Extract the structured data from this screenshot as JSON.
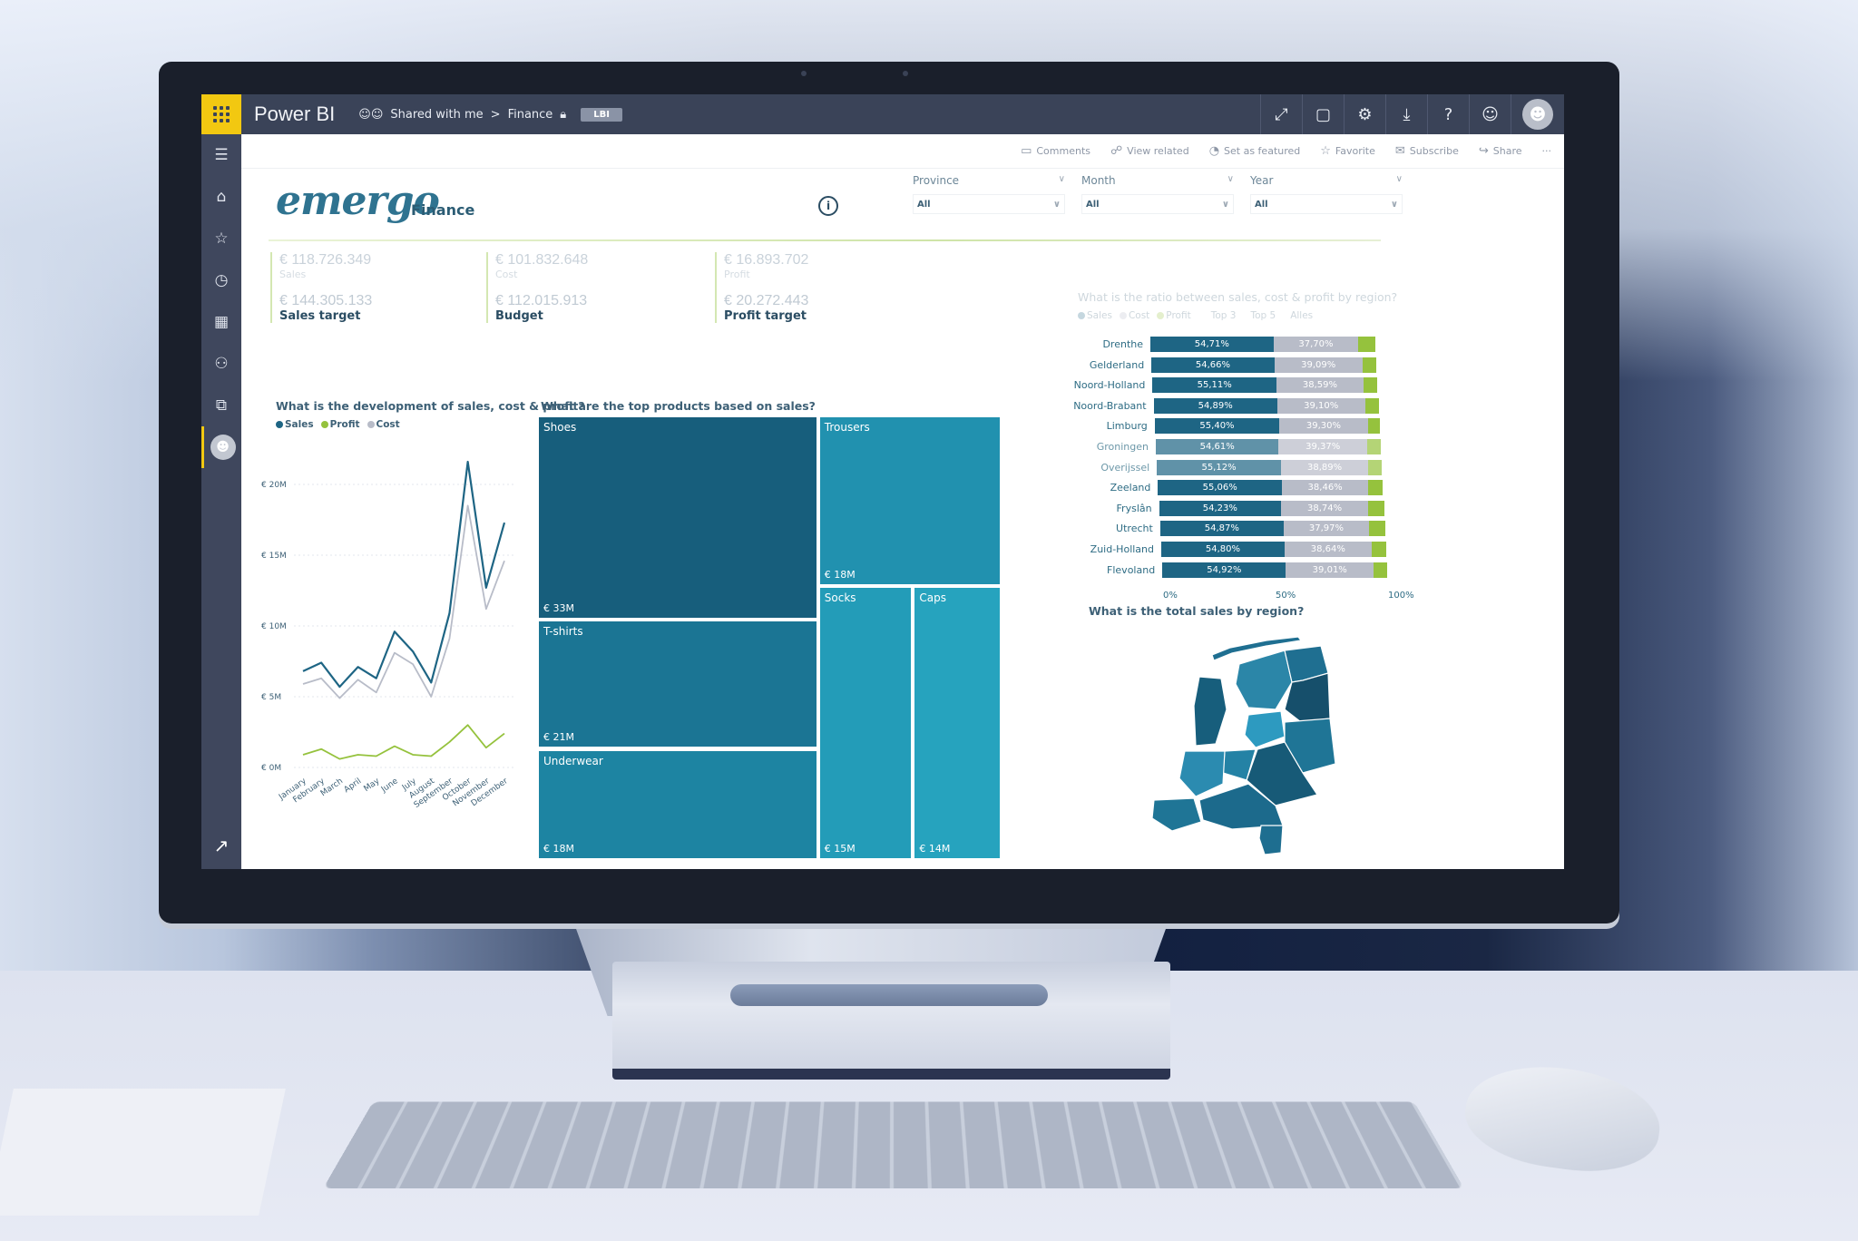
{
  "topbar": {
    "app_title": "Power BI",
    "breadcrumb_shared": "Shared with me",
    "breadcrumb_separator": ">",
    "breadcrumb_workspace": "Finance",
    "badge": "LBI",
    "icons": [
      "fullscreen-icon",
      "comment-icon",
      "gear-icon",
      "download-icon",
      "help-icon",
      "feedback-smiley-icon",
      "account-avatar-icon"
    ],
    "brand_color": "#f2c811",
    "bar_color": "#3a4358"
  },
  "leftnav": {
    "items": [
      "menu-icon",
      "home-icon",
      "favorites-star-icon",
      "recent-clock-icon",
      "apps-icon",
      "shared-people-icon",
      "workspaces-icon",
      "user-avatar-icon"
    ],
    "expand_icon": "expand-arrow-icon"
  },
  "actionbar": {
    "comments": "Comments",
    "view_related": "View related",
    "set_as_featured": "Set as featured",
    "favorite": "Favorite",
    "subscribe": "Subscribe",
    "share": "Share",
    "more": "···"
  },
  "report": {
    "logo": "emergo",
    "logo_subtitle": "Finance",
    "info_icon": "i",
    "slicers": [
      {
        "label": "Province",
        "value": "All"
      },
      {
        "label": "Month",
        "value": "All"
      },
      {
        "label": "Year",
        "value": "All"
      }
    ],
    "kpis": [
      {
        "value": "€ 118.726.349",
        "label": "Sales",
        "target_value": "€ 144.305.133",
        "target_label": "Sales target"
      },
      {
        "value": "€ 101.832.648",
        "label": "Cost",
        "target_value": "€ 112.015.913",
        "target_label": "Budget"
      },
      {
        "value": "€ 16.893.702",
        "label": "Profit",
        "target_value": "€ 20.272.443",
        "target_label": "Profit target"
      }
    ],
    "accent_color": "#1e6584",
    "profit_color": "#95c23d",
    "cost_color": "#b8bcc8"
  },
  "chart_data": [
    {
      "type": "line",
      "title": "What is the development of sales, cost & profit?",
      "legend": [
        "Sales",
        "Profit",
        "Cost"
      ],
      "legend_position": "top-left",
      "x": [
        "January",
        "February",
        "March",
        "April",
        "May",
        "June",
        "July",
        "August",
        "September",
        "October",
        "November",
        "December"
      ],
      "y_ticks": [
        "€ 0M",
        "€ 5M",
        "€ 10M",
        "€ 15M",
        "€ 20M"
      ],
      "ylim": [
        0,
        20
      ],
      "grid": true,
      "series": [
        {
          "name": "Sales",
          "color": "#1e6584",
          "values": [
            6.8,
            7.4,
            5.7,
            7.1,
            6.3,
            9.6,
            8.2,
            6.0,
            10.9,
            21.6,
            12.7,
            17.3
          ]
        },
        {
          "name": "Cost",
          "color": "#b8bcc8",
          "values": [
            5.9,
            6.3,
            4.9,
            6.2,
            5.3,
            8.1,
            7.3,
            5.0,
            9.1,
            18.5,
            11.2,
            14.6
          ]
        },
        {
          "name": "Profit",
          "color": "#95c23d",
          "values": [
            0.9,
            1.3,
            0.6,
            0.9,
            0.8,
            1.5,
            0.9,
            0.8,
            1.8,
            3.0,
            1.4,
            2.4
          ]
        }
      ]
    },
    {
      "type": "treemap",
      "title": "What are the top products based on sales?",
      "items": [
        {
          "name": "Shoes",
          "label": "€ 33M",
          "value": 33,
          "color": "#175e7c"
        },
        {
          "name": "T-shirts",
          "label": "€ 21M",
          "value": 21,
          "color": "#1b7594"
        },
        {
          "name": "Underwear",
          "label": "€ 18M",
          "value": 18,
          "color": "#1d84a2"
        },
        {
          "name": "Trousers",
          "label": "€ 18M",
          "value": 18,
          "color": "#2191af"
        },
        {
          "name": "Socks",
          "label": "€ 15M",
          "value": 15,
          "color": "#239cb8"
        },
        {
          "name": "Caps",
          "label": "€ 14M",
          "value": 14,
          "color": "#26a3be"
        }
      ]
    },
    {
      "type": "bar",
      "stacked": "100%",
      "orientation": "horizontal",
      "title": "What is the ratio between sales, cost & profit by region?",
      "legend": [
        "Sales",
        "Cost",
        "Profit"
      ],
      "filters": [
        "Top 3",
        "Top 5",
        "Alles"
      ],
      "x_ticks": [
        "0%",
        "50%",
        "100%"
      ],
      "categories": [
        "Drenthe",
        "Gelderland",
        "Noord-Holland",
        "Noord-Brabant",
        "Limburg",
        "Groningen",
        "Overijssel",
        "Zeeland",
        "Fryslân",
        "Utrecht",
        "Zuid-Holland",
        "Flevoland"
      ],
      "series": [
        {
          "name": "Sales",
          "values": [
            54.71,
            54.66,
            55.11,
            54.89,
            55.4,
            54.61,
            55.12,
            55.06,
            54.23,
            54.87,
            54.8,
            54.92
          ],
          "labels": [
            "54,71%",
            "54,66%",
            "55,11%",
            "54,89%",
            "55,40%",
            "54,61%",
            "55,12%",
            "55,06%",
            "54,23%",
            "54,87%",
            "54,80%",
            "54,92%"
          ]
        },
        {
          "name": "Cost",
          "values": [
            37.7,
            39.09,
            38.59,
            39.1,
            39.3,
            39.37,
            38.89,
            38.46,
            38.74,
            37.97,
            38.64,
            39.01
          ],
          "labels": [
            "37,70%",
            "39,09%",
            "38,59%",
            "39,10%",
            "39,30%",
            "39,37%",
            "38,89%",
            "38,46%",
            "38,74%",
            "37,97%",
            "38,64%",
            "39,01%"
          ]
        },
        {
          "name": "Profit",
          "values": [
            7.59,
            6.25,
            6.3,
            6.01,
            5.3,
            6.02,
            5.99,
            6.48,
            7.03,
            7.16,
            6.56,
            6.07
          ]
        }
      ]
    },
    {
      "type": "map",
      "title": "What is the total sales by region?",
      "region": "Netherlands provinces (filled map)"
    }
  ]
}
